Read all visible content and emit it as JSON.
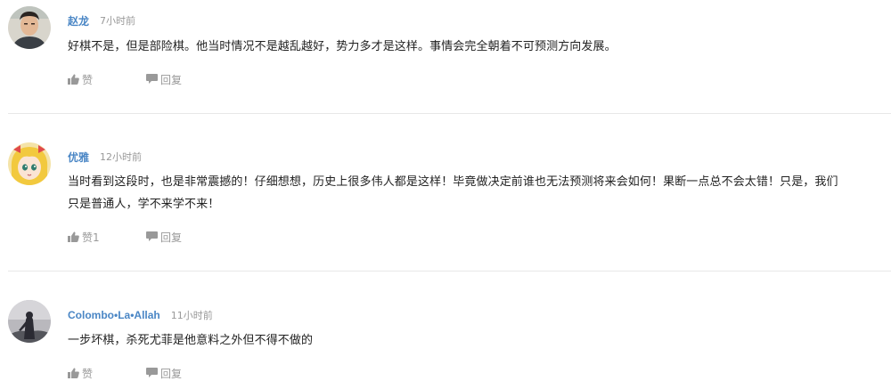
{
  "comments": [
    {
      "username": "赵龙",
      "time": "7小时前",
      "lines": [
        "好棋不是，但是部险棋。他当时情况不是越乱越好，势力多才是这样。事情会完全朝着不可预测方向发展。"
      ],
      "like_label": "赞",
      "reply_label": "回复",
      "avatar_icon": "person-photo-avatar"
    },
    {
      "username": "优雅",
      "time": "12小时前",
      "lines": [
        "当时看到这段时，也是非常震撼的！仔细想想，历史上很多伟人都是这样！毕竟做决定前谁也无法预测将来会如何！果断一点总不会太错！只是，我们",
        "只是普通人，学不来学不来！"
      ],
      "like_label": "赞1",
      "reply_label": "回复",
      "avatar_icon": "anime-girl-avatar"
    },
    {
      "username": "Colombo•La•Allah",
      "time": "11小时前",
      "lines": [
        "一步坏棋，杀死尤菲是他意料之外但不得不做的"
      ],
      "like_label": "赞",
      "reply_label": "回复",
      "avatar_icon": "dark-figure-avatar"
    }
  ],
  "icons": {
    "like": "thumbs-up-icon",
    "reply": "speech-bubble-icon"
  },
  "colors": {
    "username": "#4a86c5",
    "meta": "#999999",
    "divider": "#e8e8e8"
  }
}
